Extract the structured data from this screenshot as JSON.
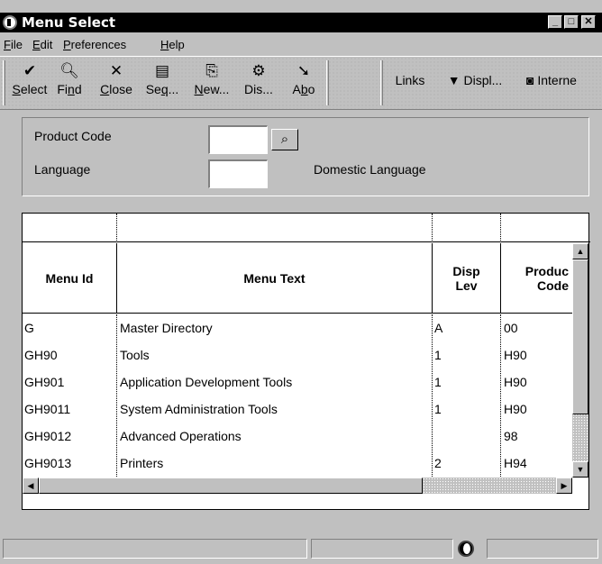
{
  "window": {
    "title": "Menu Select",
    "buttons": [
      "minimize",
      "maximize",
      "close"
    ]
  },
  "menubar": {
    "items": [
      {
        "label": "File",
        "mnemonic": "F"
      },
      {
        "label": "Edit",
        "mnemonic": "E"
      },
      {
        "label": "Preferences",
        "mnemonic": "P"
      },
      {
        "label": "Help",
        "mnemonic": "H"
      }
    ]
  },
  "toolbar": {
    "select": {
      "mn": "S",
      "rest": "elect",
      "icon": "checkmark-icon"
    },
    "find": {
      "pre": "Fi",
      "mn": "n",
      "rest": "d",
      "icon": "find-icon"
    },
    "close": {
      "mn": "C",
      "rest": "lose",
      "icon": "x-icon"
    },
    "seq": {
      "pre": "Se",
      "mn": "q",
      "rest": "...",
      "icon": "sequence-icon"
    },
    "new": {
      "mn": "N",
      "rest": "ew...",
      "icon": "new-icon"
    },
    "dis": {
      "label": "Dis...",
      "icon": "display-icon"
    },
    "abo": {
      "pre": "A",
      "mn": "b",
      "rest": "o",
      "icon": "about-icon"
    },
    "links": {
      "label": "Links"
    },
    "displ": {
      "label": "Displ..."
    },
    "internet": {
      "label": "Interne"
    }
  },
  "header": {
    "product_code_label": "Product Code",
    "product_code_value": "",
    "language_label": "Language",
    "language_value": "",
    "domestic_language": "Domestic Language"
  },
  "grid": {
    "columns": [
      {
        "key": "menu_id",
        "label": "Menu Id"
      },
      {
        "key": "menu_text",
        "label": "Menu Text"
      },
      {
        "key": "disp_lev",
        "label": "Disp\nLev"
      },
      {
        "key": "product_code",
        "label": "Produc\nCode"
      }
    ],
    "rows": [
      {
        "menu_id": "G",
        "menu_text": "Master Directory",
        "disp_lev": "A",
        "product_code": "00"
      },
      {
        "menu_id": "GH90",
        "menu_text": "Tools",
        "disp_lev": "1",
        "product_code": "H90"
      },
      {
        "menu_id": "GH901",
        "menu_text": "Application Development Tools",
        "disp_lev": "1",
        "product_code": "H90"
      },
      {
        "menu_id": "GH9011",
        "menu_text": "System Administration Tools",
        "disp_lev": "1",
        "product_code": "H90"
      },
      {
        "menu_id": "GH9012",
        "menu_text": "Advanced Operations",
        "disp_lev": "",
        "product_code": "98"
      },
      {
        "menu_id": "GH9013",
        "menu_text": "Printers",
        "disp_lev": "2",
        "product_code": "H94"
      }
    ]
  },
  "statusbar": {
    "panes": [
      "",
      "",
      "",
      ""
    ]
  }
}
